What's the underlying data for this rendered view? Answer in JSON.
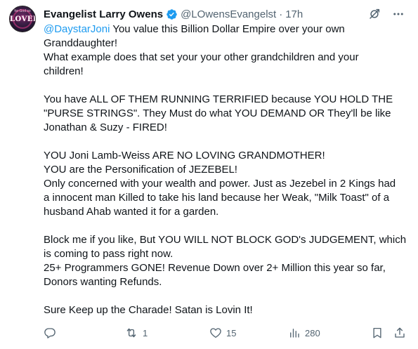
{
  "author": {
    "display_name": "Evangelist Larry Owens",
    "handle": "@LOwensEvangelst",
    "separator": "·",
    "time": "17h",
    "avatar_text_top": "for God so",
    "avatar_text_main": "LOVED"
  },
  "tweet": {
    "mention": "@DaystarJoni",
    "paragraphs": [
      [
        " You value this Billion Dollar Empire over your own",
        "Granddaughter!",
        "What example does that set your your other grandchildren and your",
        "children!"
      ],
      [
        "You have ALL OF THEM RUNNING TERRIFIED because YOU HOLD THE",
        "\"PURSE STRINGS\". They Must do what YOU DEMAND OR They'll be like",
        "Jonathan & Suzy - FIRED!"
      ],
      [
        "YOU Joni Lamb-Weiss ARE NO LOVING GRANDMOTHER!",
        "YOU are the Personification of JEZEBEL!",
        "Only concerned with your wealth and power. Just as Jezebel in 2 Kings had",
        "a innocent man Killed to take his land because her Weak, \"Milk Toast\" of a",
        "husband Ahab wanted it for a garden."
      ],
      [
        "Block me if you like, But YOU WILL NOT BLOCK GOD's JUDGEMENT, which",
        "is coming to pass right now.",
        "25+ Programmers GONE! Revenue Down over 2+ Million this year so far,",
        "Donors wanting Refunds."
      ],
      [
        "Sure Keep up the Charade! Satan is Lovin It!"
      ]
    ]
  },
  "actions": {
    "replies": "",
    "retweets": "1",
    "likes": "15",
    "views": "280"
  },
  "icons": {
    "verified": "verified-badge-icon",
    "grok": "grok-icon",
    "more": "more-icon",
    "reply": "reply-icon",
    "retweet": "retweet-icon",
    "like": "heart-icon",
    "views": "views-icon",
    "bookmark": "bookmark-icon",
    "share": "share-icon"
  },
  "colors": {
    "accent": "#1d9bf0",
    "text": "#0f1419",
    "secondary": "#536471"
  }
}
